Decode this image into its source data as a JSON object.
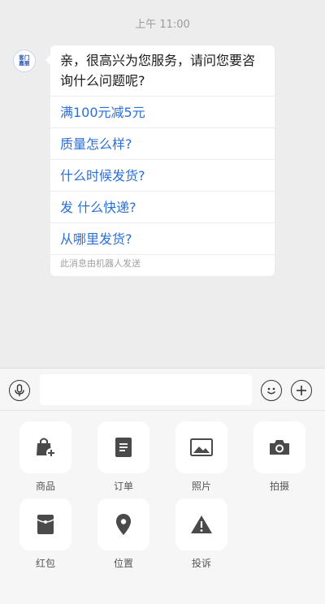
{
  "chat": {
    "timestamp": "上午 11:00",
    "avatar_text": [
      "客门",
      "嘉丽"
    ],
    "greeting": "亲，很高兴为您服务，请问您要咨询什么问题呢?",
    "questions": [
      "满100元减5元",
      "质量怎么样?",
      "什么时候发货?",
      "发 什么快递?",
      "从哪里发货?"
    ],
    "bot_note": "此消息由机器人发送"
  },
  "input": {
    "placeholder": ""
  },
  "icons": {
    "voice": "microphone-icon",
    "emoji": "smiley-icon",
    "more": "plus-icon"
  },
  "panel": {
    "items": [
      {
        "label": "商品",
        "icon": "shopping-bag-icon"
      },
      {
        "label": "订单",
        "icon": "order-document-icon"
      },
      {
        "label": "照片",
        "icon": "photo-icon"
      },
      {
        "label": "拍摄",
        "icon": "camera-icon"
      },
      {
        "label": "红包",
        "icon": "red-packet-icon"
      },
      {
        "label": "位置",
        "icon": "location-pin-icon"
      },
      {
        "label": "投诉",
        "icon": "warning-icon"
      }
    ]
  },
  "colors": {
    "link": "#2b6fd6",
    "background": "#ededed",
    "icon": "#4a4a4a"
  }
}
